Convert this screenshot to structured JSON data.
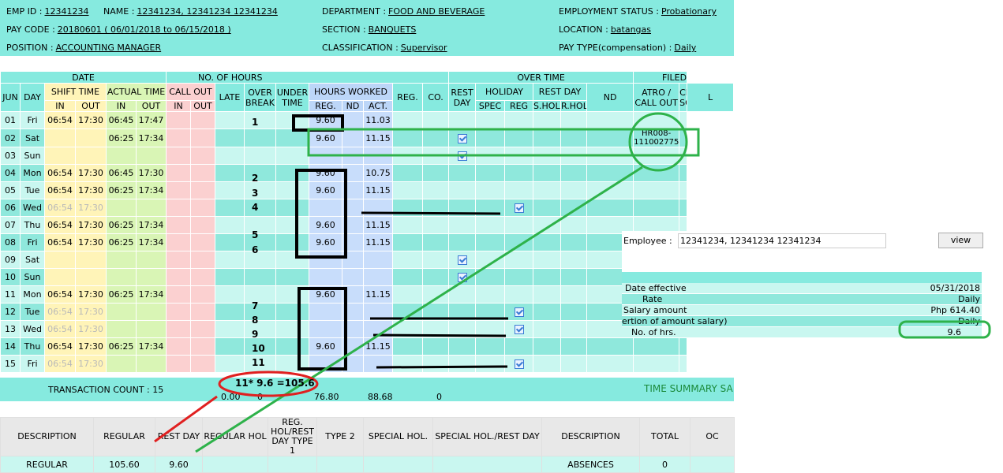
{
  "header": {
    "emp_id_label": "EMP ID :",
    "emp_id": "12341234",
    "name_label": "NAME :",
    "name": "12341234, 12341234 12341234",
    "department_label": "DEPARTMENT :",
    "department": "FOOD AND BEVERAGE",
    "employment_status_label": "EMPLOYMENT STATUS :",
    "employment_status": "Probationary",
    "pay_code_label": "PAY CODE :",
    "pay_code": "20180601 ( 06/01/2018 to 06/15/2018 )",
    "section_label": "SECTION :",
    "section": "BANQUETS",
    "location_label": "LOCATION :",
    "location": "batangas",
    "position_label": "POSITION :",
    "position": "ACCOUNTING MANAGER",
    "classification_label": "CLASSIFICATION :",
    "classification": "Supervisor",
    "pay_type_label": "PAY TYPE(compensation) :",
    "pay_type": "Daily"
  },
  "table": {
    "group_headers": {
      "date": "DATE",
      "no_of_hours": "NO. OF HOURS",
      "over_time": "OVER TIME",
      "filed": "FILED"
    },
    "headers": {
      "jun": "JUN",
      "day": "DAY",
      "shift_time": "SHIFT TIME",
      "actual_time": "ACTUAL TIME",
      "call_out": "CALL OUT",
      "late": "LATE",
      "over_break": "OVER BREAK",
      "under_time": "UNDER TIME",
      "hours_worked": "HOURS WORKED",
      "ot_reg": "REG.",
      "co": "CO.",
      "rest_day": "REST DAY",
      "holiday": "HOLIDAY",
      "rest_day2": "REST DAY",
      "nd": "ND",
      "atro": "ATRO / CALL OUT",
      "change_sched": "CHANGE SCHED.",
      "l": "L"
    },
    "sub_headers": {
      "in": "IN",
      "out": "OUT",
      "reg": "REG.",
      "nd": "ND",
      "act": "ACT.",
      "spec": "SPEC",
      "reg2": "REG",
      "s_hol": "S.HOL.",
      "r_hol": "R.HOL."
    },
    "rows": [
      {
        "date": "01",
        "day": "Fri",
        "shift_in": "06:54",
        "shift_out": "17:30",
        "act_in": "06:45",
        "act_out": "17:47",
        "reg": "9.60",
        "act": "11.03",
        "rest_check": false,
        "hol_reg_check": false,
        "atro": "",
        "muted": false
      },
      {
        "date": "02",
        "day": "Sat",
        "shift_in": "",
        "shift_out": "",
        "act_in": "06:25",
        "act_out": "17:34",
        "reg": "9.60",
        "act": "11.15",
        "rest_check": true,
        "hol_reg_check": false,
        "atro": "HR008-111002775",
        "muted": false
      },
      {
        "date": "03",
        "day": "Sun",
        "shift_in": "",
        "shift_out": "",
        "act_in": "",
        "act_out": "",
        "reg": "",
        "act": "",
        "rest_check": true,
        "hol_reg_check": false,
        "atro": "",
        "muted": false
      },
      {
        "date": "04",
        "day": "Mon",
        "shift_in": "06:54",
        "shift_out": "17:30",
        "act_in": "06:45",
        "act_out": "17:30",
        "reg": "9.60",
        "act": "10.75",
        "rest_check": false,
        "hol_reg_check": false,
        "atro": "",
        "muted": false
      },
      {
        "date": "05",
        "day": "Tue",
        "shift_in": "06:54",
        "shift_out": "17:30",
        "act_in": "06:25",
        "act_out": "17:34",
        "reg": "9.60",
        "act": "11.15",
        "rest_check": false,
        "hol_reg_check": false,
        "atro": "",
        "muted": false
      },
      {
        "date": "06",
        "day": "Wed",
        "shift_in": "06:54",
        "shift_out": "17:30",
        "act_in": "",
        "act_out": "",
        "reg": "",
        "act": "",
        "rest_check": false,
        "hol_reg_check": true,
        "atro": "",
        "muted": true
      },
      {
        "date": "07",
        "day": "Thu",
        "shift_in": "06:54",
        "shift_out": "17:30",
        "act_in": "06:25",
        "act_out": "17:34",
        "reg": "9.60",
        "act": "11.15",
        "rest_check": false,
        "hol_reg_check": false,
        "atro": "",
        "muted": false
      },
      {
        "date": "08",
        "day": "Fri",
        "shift_in": "06:54",
        "shift_out": "17:30",
        "act_in": "06:25",
        "act_out": "17:34",
        "reg": "9.60",
        "act": "11.15",
        "rest_check": false,
        "hol_reg_check": false,
        "atro": "",
        "muted": false
      },
      {
        "date": "09",
        "day": "Sat",
        "shift_in": "",
        "shift_out": "",
        "act_in": "",
        "act_out": "",
        "reg": "",
        "act": "",
        "rest_check": true,
        "hol_reg_check": false,
        "atro": "",
        "muted": false
      },
      {
        "date": "10",
        "day": "Sun",
        "shift_in": "",
        "shift_out": "",
        "act_in": "",
        "act_out": "",
        "reg": "",
        "act": "",
        "rest_check": true,
        "hol_reg_check": false,
        "atro": "",
        "muted": false
      },
      {
        "date": "11",
        "day": "Mon",
        "shift_in": "06:54",
        "shift_out": "17:30",
        "act_in": "06:25",
        "act_out": "17:34",
        "reg": "9.60",
        "act": "11.15",
        "rest_check": false,
        "hol_reg_check": false,
        "atro": "",
        "muted": false
      },
      {
        "date": "12",
        "day": "Tue",
        "shift_in": "06:54",
        "shift_out": "17:30",
        "act_in": "",
        "act_out": "",
        "reg": "",
        "act": "",
        "rest_check": false,
        "hol_reg_check": true,
        "atro": "",
        "muted": true
      },
      {
        "date": "13",
        "day": "Wed",
        "shift_in": "06:54",
        "shift_out": "17:30",
        "act_in": "",
        "act_out": "",
        "reg": "",
        "act": "",
        "rest_check": false,
        "hol_reg_check": true,
        "atro": "",
        "muted": true
      },
      {
        "date": "14",
        "day": "Thu",
        "shift_in": "06:54",
        "shift_out": "17:30",
        "act_in": "06:25",
        "act_out": "17:34",
        "reg": "9.60",
        "act": "11.15",
        "rest_check": false,
        "hol_reg_check": false,
        "atro": "",
        "muted": false
      },
      {
        "date": "15",
        "day": "Fri",
        "shift_in": "06:54",
        "shift_out": "17:30",
        "act_in": "",
        "act_out": "",
        "reg": "",
        "act": "",
        "rest_check": false,
        "hol_reg_check": true,
        "atro": "",
        "muted": true
      }
    ]
  },
  "totals": {
    "transaction_count": "TRANSACTION COUNT : 15",
    "late_total": "0.00",
    "over_break_total": "0",
    "reg_total": "76.80",
    "act_total": "88.68",
    "co_total": "0",
    "time_summary": "TIME SUMMARY SA"
  },
  "summary": {
    "headers": [
      "DESCRIPTION",
      "REGULAR",
      "REST DAY",
      "REGULAR HOL",
      "REG. HOL/REST DAY TYPE 1",
      "TYPE 2",
      "SPECIAL HOL.",
      "SPECIAL HOL./REST DAY",
      "DESCRIPTION",
      "TOTAL",
      "OC"
    ],
    "row": [
      "REGULAR",
      "105.60",
      "9.60",
      "",
      "",
      "",
      "",
      "",
      "ABSENCES",
      "0",
      ""
    ]
  },
  "popup": {
    "employee_label": "Employee :",
    "employee_value": "12341234, 12341234 12341234",
    "view_label": "view",
    "rows": [
      {
        "label": "Date effective",
        "value": "05/31/2018"
      },
      {
        "label": "Rate",
        "value": "Daily"
      },
      {
        "label": "Salary amount",
        "value": "Php 614.40"
      },
      {
        "label": "ertion of amount salary)",
        "value": "Daily"
      },
      {
        "label": "No. of hrs.",
        "value": "9.6"
      }
    ]
  },
  "annotations": {
    "numbers": [
      "1",
      "2",
      "3",
      "4",
      "5",
      "6",
      "7",
      "8",
      "9",
      "10",
      "11"
    ],
    "formula": "11* 9.6 =105.6"
  }
}
